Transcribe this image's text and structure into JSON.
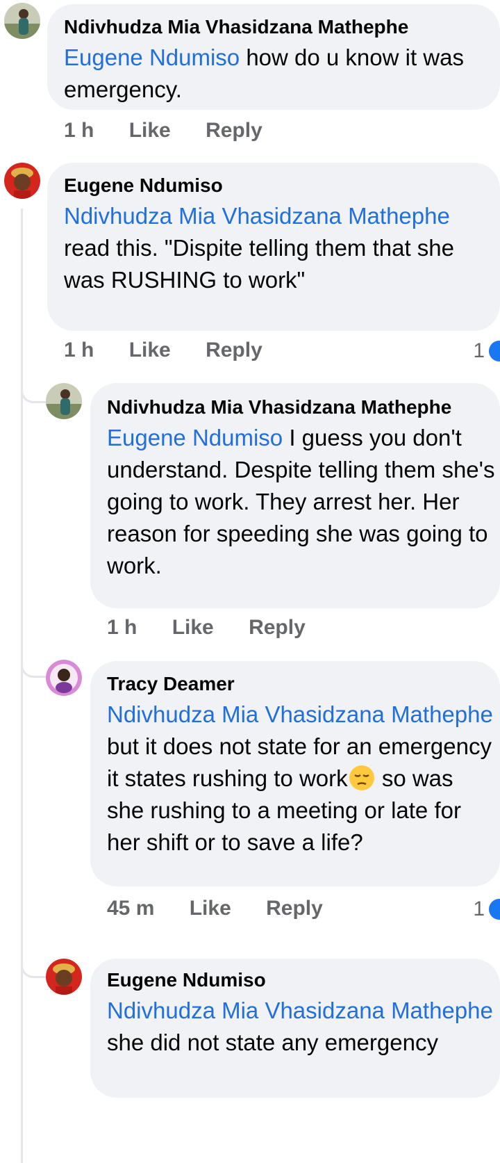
{
  "comments": [
    {
      "author": "Ndivhudza Mia Vhasidzana Mathephe",
      "mention": "Eugene Ndumiso",
      "body": " how do u know it was emergency.",
      "time": "1 h",
      "like": "Like",
      "reply": "Reply"
    },
    {
      "author": "Eugene Ndumiso",
      "mention": "Ndivhudza Mia Vhasidzana Mathephe",
      "body": " read this. \"Dispite telling them that she was RUSHING to work\"",
      "time": "1 h",
      "like": "Like",
      "reply": "Reply",
      "reaction_count": "1"
    },
    {
      "author": "Ndivhudza Mia Vhasidzana Mathephe",
      "mention": "Eugene Ndumiso",
      "body": " I guess you don't understand. Despite telling them she's going to work. They arrest her. Her reason for speeding she was going to work.",
      "time": "1 h",
      "like": "Like",
      "reply": "Reply"
    },
    {
      "author": "Tracy Deamer",
      "mention": "Ndivhudza Mia Vhasidzana Mathephe",
      "body_before_emoji": " but it does not state for an emergency it states rushing to work",
      "body_after_emoji": " so was she rushing to a meeting or late for her shift or to save a life?",
      "emoji": "pensive-face",
      "time": "45 m",
      "like": "Like",
      "reply": "Reply",
      "reaction_count": "1"
    },
    {
      "author": "Eugene Ndumiso",
      "mention": "Ndivhudza Mia Vhasidzana Mathephe",
      "body": "  she did not state any emergency"
    }
  ],
  "colors": {
    "mention": "#216fdb",
    "bubble": "#f0f2f5",
    "meta": "#65676b",
    "reaction": "#1877f2"
  }
}
